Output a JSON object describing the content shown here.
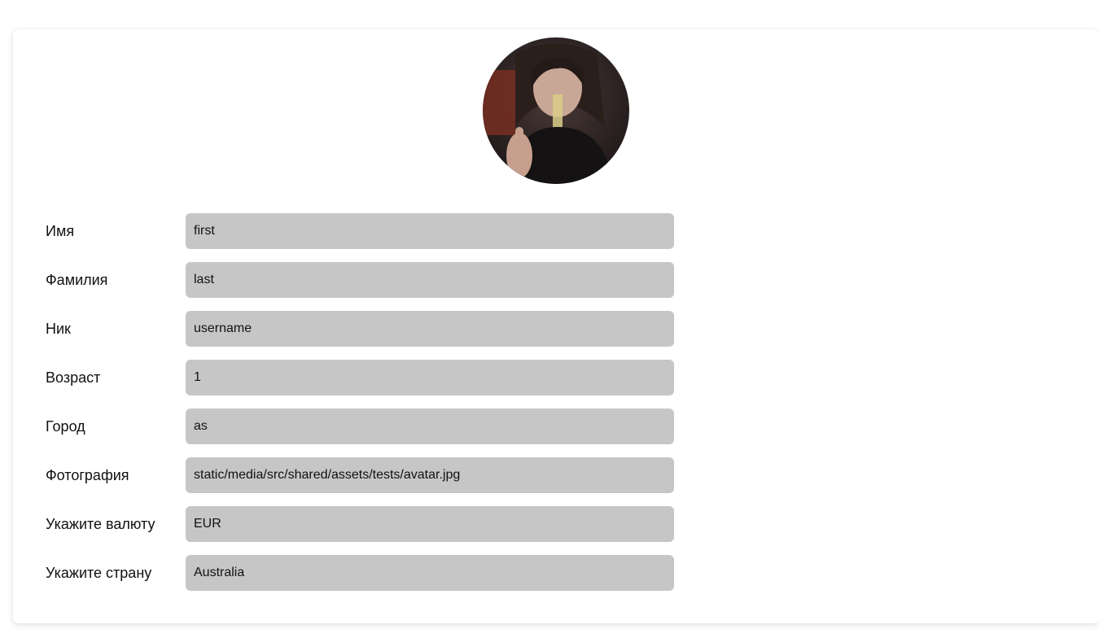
{
  "profile": {
    "avatar_alt": "avatar",
    "fields": [
      {
        "label": "Имя",
        "value": "first"
      },
      {
        "label": "Фамилия",
        "value": "last"
      },
      {
        "label": "Ник",
        "value": "username"
      },
      {
        "label": "Возраст",
        "value": "1"
      },
      {
        "label": "Город",
        "value": "as"
      },
      {
        "label": "Фотография",
        "value": "static/media/src/shared/assets/tests/avatar.jpg"
      },
      {
        "label": "Укажите валюту",
        "value": "EUR"
      },
      {
        "label": "Укажите страну",
        "value": "Australia"
      }
    ]
  },
  "colors": {
    "field_bg": "#c6c6c6",
    "text": "#111111",
    "card_bg": "#ffffff"
  }
}
